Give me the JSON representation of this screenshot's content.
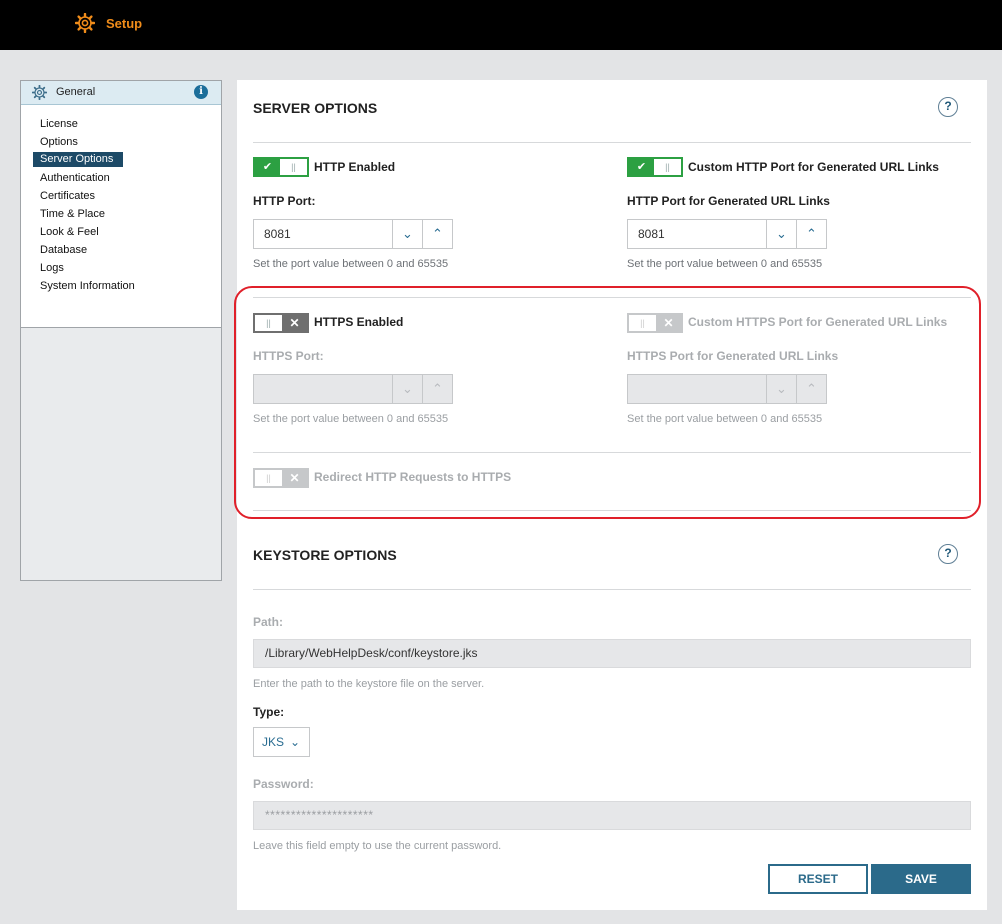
{
  "app": {
    "title": "Setup"
  },
  "sidebar": {
    "header": "General",
    "items": [
      {
        "label": "License"
      },
      {
        "label": "Options"
      },
      {
        "label": "Server Options",
        "active": true
      },
      {
        "label": "Authentication"
      },
      {
        "label": "Certificates"
      },
      {
        "label": "Time & Place"
      },
      {
        "label": "Look & Feel"
      },
      {
        "label": "Database"
      },
      {
        "label": "Logs"
      },
      {
        "label": "System Information"
      }
    ]
  },
  "server": {
    "title": "SERVER OPTIONS",
    "help": "?",
    "http_enabled": {
      "label": "HTTP Enabled",
      "state": "on"
    },
    "custom_http": {
      "label": "Custom HTTP Port for Generated URL Links",
      "state": "on"
    },
    "http_port": {
      "label": "HTTP Port:",
      "value": "8081",
      "hint": "Set the port value between 0 and 65535"
    },
    "http_gen_port": {
      "label": "HTTP Port for Generated URL Links",
      "value": "8081",
      "hint": "Set the port value between 0 and 65535"
    },
    "https_enabled": {
      "label": "HTTPS Enabled",
      "state": "off"
    },
    "custom_https": {
      "label": "Custom HTTPS Port for Generated URL Links",
      "state": "disabled"
    },
    "https_port": {
      "label": "HTTPS Port:",
      "value": "",
      "hint": "Set the port value between 0 and 65535"
    },
    "https_gen_port": {
      "label": "HTTPS Port for Generated URL Links",
      "value": "",
      "hint": "Set the port value between 0 and 65535"
    },
    "redirect": {
      "label": "Redirect HTTP Requests to HTTPS",
      "state": "disabled"
    }
  },
  "keystore": {
    "title": "KEYSTORE OPTIONS",
    "help": "?",
    "path": {
      "label": "Path:",
      "value": "/Library/WebHelpDesk/conf/keystore.jks",
      "hint": "Enter the path to the keystore file on the server."
    },
    "type": {
      "label": "Type:",
      "value": "JKS"
    },
    "password": {
      "label": "Password:",
      "value": "*********************",
      "hint": "Leave this field empty to use the current password."
    }
  },
  "actions": {
    "reset": "RESET",
    "save": "SAVE"
  },
  "colors": {
    "accent": "#2b6a8a",
    "toggle_on": "#2ca042",
    "highlight": "#e0202a",
    "brand": "#f08c1a"
  }
}
